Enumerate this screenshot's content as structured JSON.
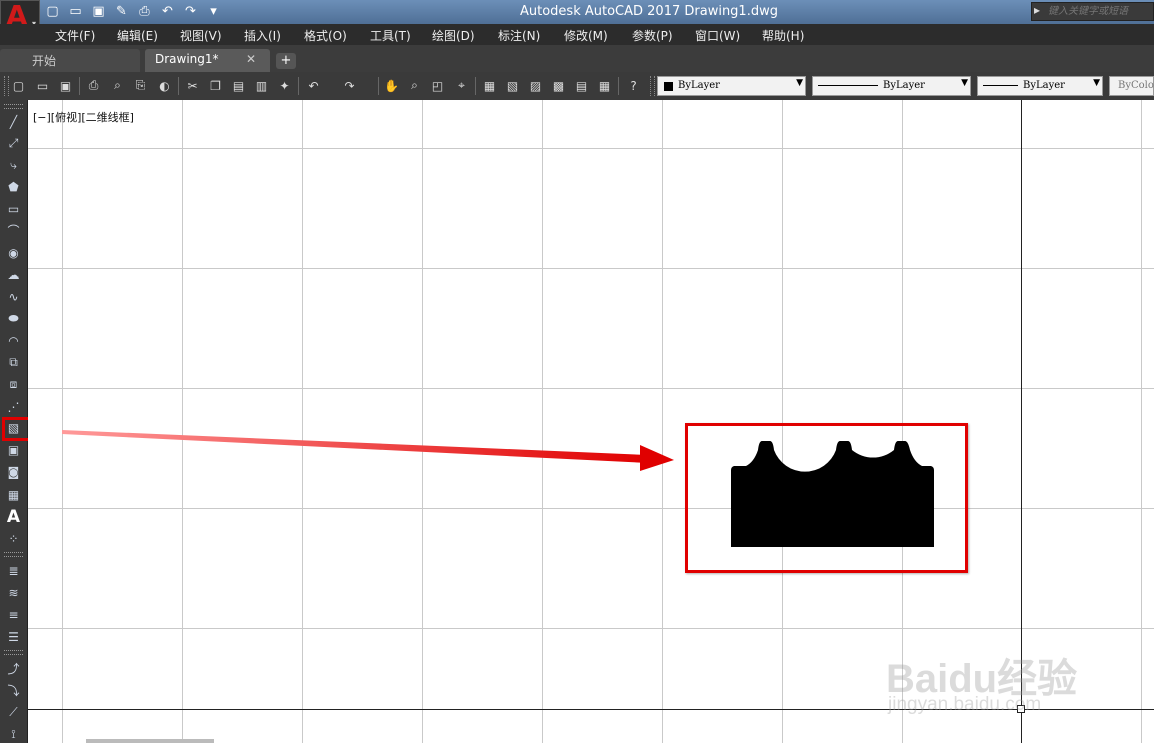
{
  "window": {
    "title": "Autodesk AutoCAD 2017    Drawing1.dwg",
    "search_placeholder": "键入关键字或短语"
  },
  "app_button": {
    "logo": "A",
    "arrow": "▾"
  },
  "quick_access": [
    "new-icon",
    "open-icon",
    "save-icon",
    "saveas-icon",
    "plot-icon",
    "undo-icon",
    "redo-icon",
    "customize-icon"
  ],
  "menu": [
    "文件(F)",
    "编辑(E)",
    "视图(V)",
    "插入(I)",
    "格式(O)",
    "工具(T)",
    "绘图(D)",
    "标注(N)",
    "修改(M)",
    "参数(P)",
    "窗口(W)",
    "帮助(H)"
  ],
  "tabs": {
    "start": "开始",
    "drawing": "Drawing1*",
    "close": "✕",
    "new": "+"
  },
  "properties": {
    "color": "ByLayer",
    "linetype": "ByLayer",
    "lineweight": "ByLayer",
    "plotstyle": "ByColo"
  },
  "viewport": {
    "label": "[−][俯视][二维线框]"
  },
  "left_tools": [
    "line-icon",
    "construction-line-icon",
    "polyline-icon",
    "polygon-icon",
    "rectangle-icon",
    "arc-icon",
    "circle-icon",
    "revision-cloud-icon",
    "spline-icon",
    "ellipse-icon",
    "ellipse-arc-icon",
    "insert-block-icon",
    "make-block-icon",
    "point-icon",
    "hatch-icon",
    "gradient-icon",
    "region-icon",
    "table-icon",
    "mtext-icon",
    "add-selected-icon"
  ],
  "highlighted_tool": "hatch-icon",
  "watermark": {
    "brand": "Baidu经验",
    "url": "jingyan.baidu.com"
  },
  "colors": {
    "highlight": "#e00000",
    "canvas": "#ffffff",
    "chrome": "#3a3a3a"
  }
}
